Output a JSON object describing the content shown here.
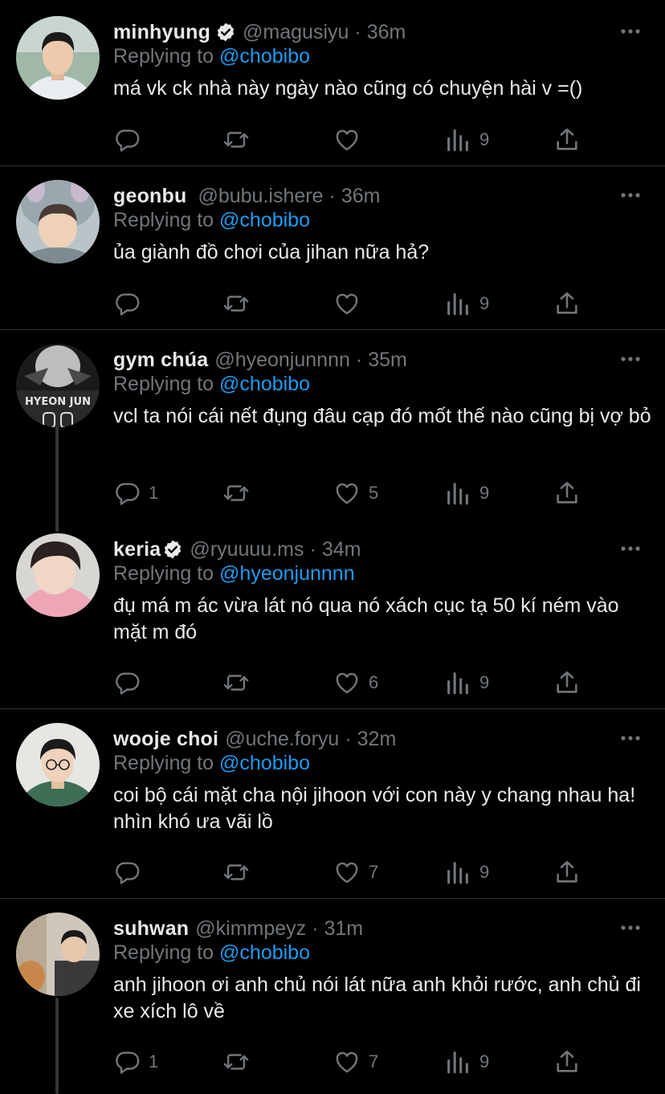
{
  "mention_color": "#1d9bf0",
  "replying_prefix": "Replying to",
  "tweets": [
    {
      "name": "minhyung",
      "verified": true,
      "handle": "@magusiyu",
      "time": "36m",
      "replying_to": "@chobibo",
      "text": "má vk ck nhà này ngày nào cũng có chuyện hài v =()",
      "replies": "",
      "retweets": "",
      "likes": "",
      "views": "9"
    },
    {
      "name": "geonbu",
      "verified": false,
      "handle": "@bubu.ishere",
      "time": "36m",
      "replying_to": "@chobibo",
      "text": "ủa giành đồ chơi của jihan nữa hả?",
      "replies": "",
      "retweets": "",
      "likes": "",
      "views": "9"
    },
    {
      "name": "gym chúa",
      "verified": false,
      "handle": "@hyeonjunnnn",
      "time": "35m",
      "replying_to": "@chobibo",
      "text": "vcl ta nói cái nết đụng đâu cạp đó mốt thế nào cũng bị vợ bỏ",
      "replies": "1",
      "retweets": "",
      "likes": "5",
      "views": "9",
      "avatar_text": "HYEON JUN"
    },
    {
      "name": "keria",
      "verified": true,
      "handle": "@ryuuuu.ms",
      "time": "34m",
      "replying_to": "@hyeonjunnnn",
      "text": "đụ má m ác vừa lát nó qua nó xách cục tạ 50 kí ném vào mặt m đó",
      "replies": "",
      "retweets": "",
      "likes": "6",
      "views": "9"
    },
    {
      "name": "wooje choi",
      "verified": false,
      "handle": "@uche.foryu",
      "time": "32m",
      "replying_to": "@chobibo",
      "text": "coi bộ cái mặt cha nội jihoon với con này y chang nhau ha! nhìn khó ưa vãi lồ",
      "replies": "",
      "retweets": "",
      "likes": "7",
      "views": "9"
    },
    {
      "name": "suhwan",
      "verified": false,
      "handle": "@kimmpeyz",
      "time": "31m",
      "replying_to": "@chobibo",
      "text": "anh jihoon ơi anh chủ nói lát nữa anh khỏi rước, anh chủ đi xe xích lô về",
      "replies": "1",
      "retweets": "",
      "likes": "7",
      "views": "9"
    }
  ]
}
